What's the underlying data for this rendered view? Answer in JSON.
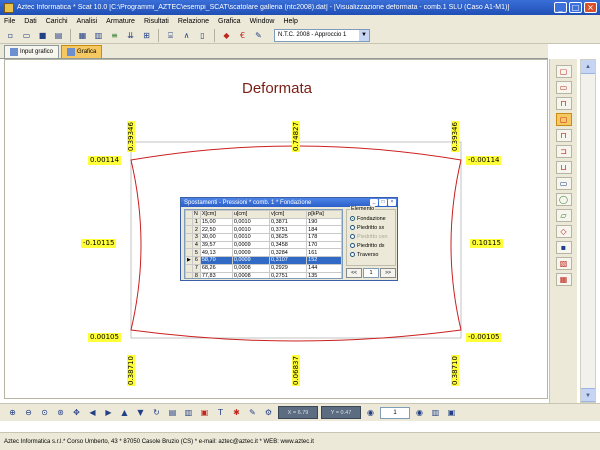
{
  "window": {
    "title": "Aztec Informatica * Scat 10.0 [C:\\Programmi_AZTEC\\esempi_SCAT\\scatolare galleria (ntc2008).dat] - [Visualizzazione deformata - comb.1 SLU (Caso A1-M1)]",
    "buttons": [
      "_",
      "□",
      "×"
    ]
  },
  "menu": [
    "File",
    "Dati",
    "Carichi",
    "Analisi",
    "Armature",
    "Risultati",
    "Relazione",
    "Grafica",
    "Window",
    "Help"
  ],
  "toolbar": {
    "normativa": "N.T.C. 2008 - Approccio 1"
  },
  "tabs": [
    {
      "label": "Input grafico",
      "active": false
    },
    {
      "label": "Grafica",
      "active": true
    }
  ],
  "drawing": {
    "title": "Deformata",
    "labels": {
      "top_left": "0.39346",
      "top_center": "0.74827",
      "top_right": "0.39346",
      "bottom_left": "0.38710",
      "bottom_center": "0.06837",
      "bottom_right": "0.38710",
      "left_top": "0.00114",
      "left_middle": "-0.10115",
      "left_bottom": "0.00105",
      "right_top": "-0.00114",
      "right_middle": "0.10115",
      "right_bottom": "-0.00105"
    },
    "colors": {
      "deformed": "#cc1f1f",
      "undeformed": "#b5b5b5",
      "label_bg": "#ffff3a",
      "title": "#7a1e14"
    }
  },
  "dialog": {
    "title": "Spostamenti - Pressioni * comb. 1 * Fondazione",
    "columns": [
      "N",
      "X[cm]",
      "u[cm]",
      "v[cm]",
      "p[kPa]"
    ],
    "rows": [
      [
        "1",
        "15,00",
        "0,0010",
        "0,3871",
        "190"
      ],
      [
        "2",
        "22,50",
        "0,0010",
        "0,3751",
        "184"
      ],
      [
        "3",
        "30,00",
        "0,0010",
        "0,3625",
        "178"
      ],
      [
        "4",
        "39,57",
        "0,0009",
        "0,3458",
        "170"
      ],
      [
        "5",
        "49,13",
        "0,0009",
        "0,3284",
        "161"
      ],
      [
        "6",
        "58,70",
        "0,0009",
        "0,3107",
        "152"
      ],
      [
        "7",
        "68,26",
        "0,0008",
        "0,2929",
        "144"
      ],
      [
        "8",
        "77,83",
        "0,0008",
        "0,2751",
        "135"
      ]
    ],
    "selected_row": 5,
    "element_group_title": "Elemento",
    "elements": [
      {
        "label": "Fondazione",
        "checked": true,
        "disabled": false
      },
      {
        "label": "Piedritto sx",
        "checked": false,
        "disabled": false
      },
      {
        "label": "Piedritto cen",
        "checked": false,
        "disabled": true
      },
      {
        "label": "Piedritto dx",
        "checked": false,
        "disabled": false
      },
      {
        "label": "Traverso",
        "checked": false,
        "disabled": false
      }
    ],
    "pager": {
      "prev": "<<",
      "page": "1",
      "next": ">>"
    }
  },
  "bottombar": {
    "coord_x": "X = 6.79",
    "coord_y": "Y = 0.47",
    "page": "1"
  },
  "status": "Aztec Informatica s.r.l.* Corso Umberto, 43 * 87050 Casole Bruzio (CS)  *  e-mail:  aztec@aztec.it  *  WEB: www.aztec.it"
}
